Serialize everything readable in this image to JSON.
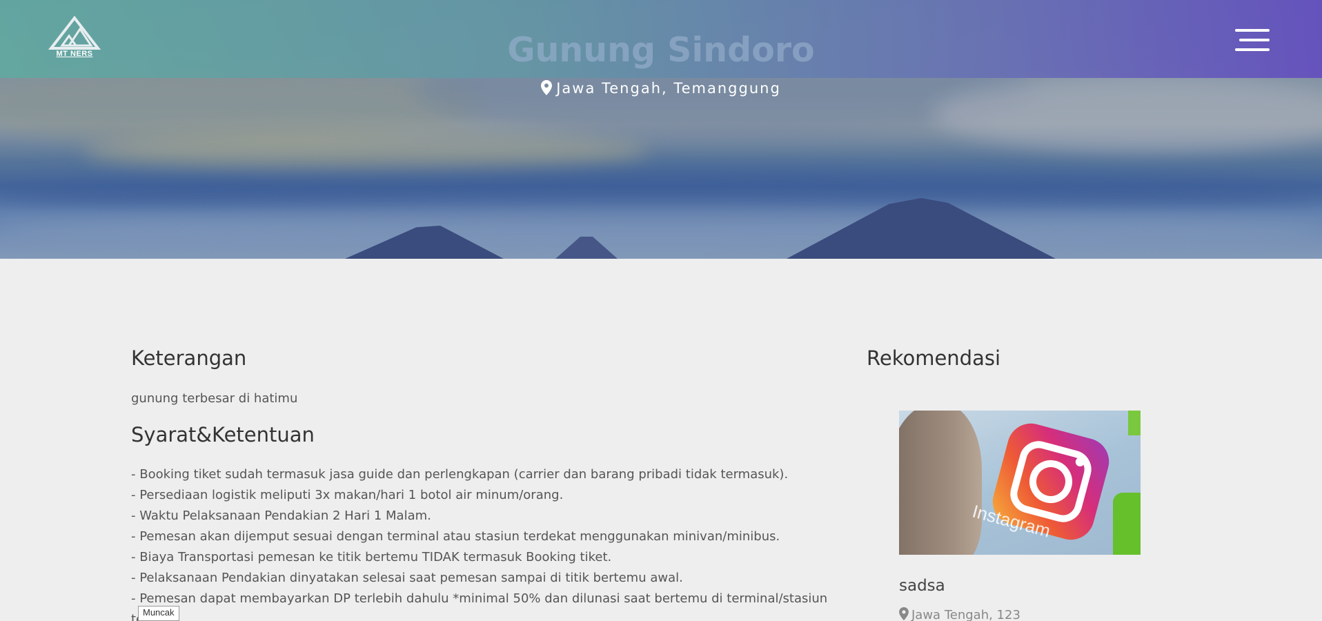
{
  "navbar": {
    "logo_text": "MT NERS",
    "menu_icon": "hamburger-menu-icon"
  },
  "hero": {
    "title": "Gunung Sindoro",
    "location": "Jawa Tengah, Temanggung",
    "location_icon": "map-pin-icon"
  },
  "main": {
    "description_heading": "Keterangan",
    "description_text": "gunung terbesar di hatimu",
    "terms_heading": "Syarat&Ketentuan",
    "terms": [
      "- Booking tiket sudah termasuk jasa guide dan perlengkapan (carrier dan barang pribadi tidak termasuk).",
      "- Persediaan logistik meliputi 3x makan/hari 1 botol air minum/orang.",
      "- Waktu Pelaksanaan Pendakian 2 Hari 1 Malam.",
      "- Pemesan akan dijemput sesuai dengan terminal atau stasiun terdekat menggunakan minivan/minibus.",
      "- Biaya Transportasi pemesan ke titik bertemu TIDAK termasuk Booking tiket.",
      "- Pelaksanaan Pendakian dinyatakan selesai saat pemesan sampai di titik bertemu awal.",
      "- Pemesan dapat membayarkan DP terlebih dahulu *minimal 50% dan dilunasi saat bertemu di terminal/stasiun",
      "te"
    ]
  },
  "recommendation": {
    "heading": "Rekomendasi",
    "item": {
      "image_icon": "instagram-logo-icon",
      "image_text": "Instagram",
      "title": "sadsa",
      "location": "Jawa Tengah, 123"
    }
  },
  "tooltip": {
    "text": "Muncak"
  },
  "colors": {
    "navbar_start": "#62a8a0",
    "navbar_end": "#6450be",
    "page_bg": "#eeeeee",
    "heading": "#333333",
    "body_text": "#555555"
  }
}
